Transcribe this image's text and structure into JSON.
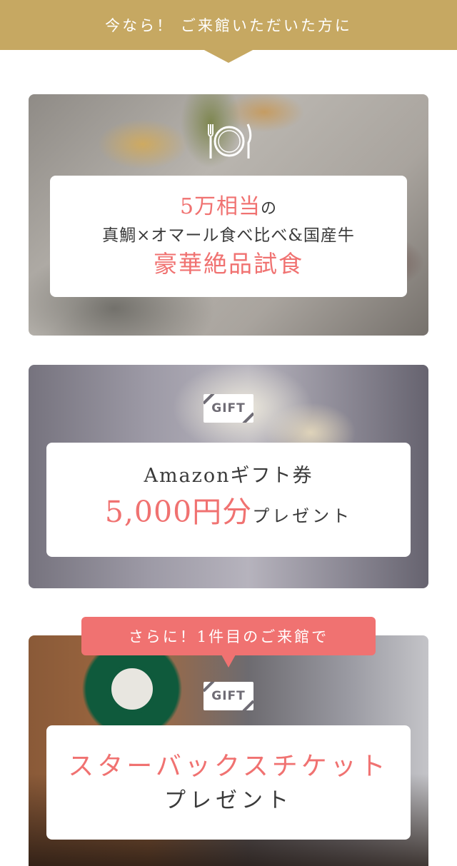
{
  "top_banner": {
    "text": "今なら！ ご来館いただいた方に"
  },
  "card_food": {
    "icon": "plate-cutlery-icon",
    "value_label": "5万相当",
    "particle": "の",
    "menu": "真鯛×オマール食べ比べ&国産牛",
    "title": "豪華絶品試食"
  },
  "card_amazon": {
    "icon": "gift-icon",
    "gift_badge": "GIFT",
    "name": "Amazonギフト券",
    "amount": "5,000円分",
    "suffix": "プレゼント"
  },
  "extra_tag": {
    "text": "さらに！1件目のご来館で"
  },
  "card_starbucks": {
    "icon": "gift-icon",
    "gift_badge": "GIFT",
    "title": "スターバックスチケット",
    "suffix": "プレゼント"
  },
  "colors": {
    "gold": "#c6a862",
    "pink": "#f07271",
    "text": "#3a3a3a"
  }
}
